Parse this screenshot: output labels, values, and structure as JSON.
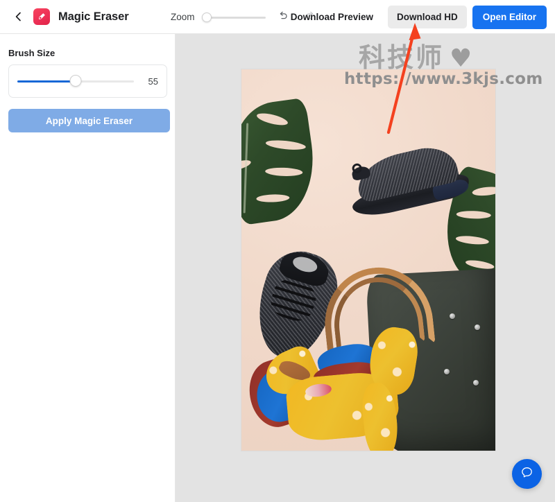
{
  "header": {
    "back_icon": "chevron-left-icon",
    "app_icon": "magic-eraser-app-icon",
    "title": "Magic Eraser",
    "zoom_label": "Zoom",
    "zoom_value": 0,
    "undo_icon": "undo-icon",
    "redo_icon": "redo-icon",
    "download_preview_label": "Download Preview",
    "download_hd_label": "Download HD",
    "open_editor_label": "Open Editor",
    "primary_color": "#1773f0",
    "hover_bg": "#ebebeb"
  },
  "sidebar": {
    "brush_size_label": "Brush Size",
    "brush_size_value": "55",
    "brush_fill_percent": 50,
    "apply_label": "Apply Magic Eraser",
    "apply_color": "#7fabe6",
    "slider_color": "#1667d6"
  },
  "canvas": {
    "background": "#e3e3e3",
    "photo_alt": "flat-lay product photo: two dark knit sneakers, monstera leaves, yellow and blue patterned scarf, dark green leather tote bag on peach background"
  },
  "watermark": {
    "text_cn": "科技师",
    "heart": "♥",
    "url": "https://www.3kjs.com",
    "color": "#a6a6a6"
  },
  "annotation": {
    "arrow_color": "#f4411f",
    "arrow_target": "Download HD"
  },
  "help": {
    "icon": "chat-bubble-icon",
    "color": "#0b63e5"
  }
}
